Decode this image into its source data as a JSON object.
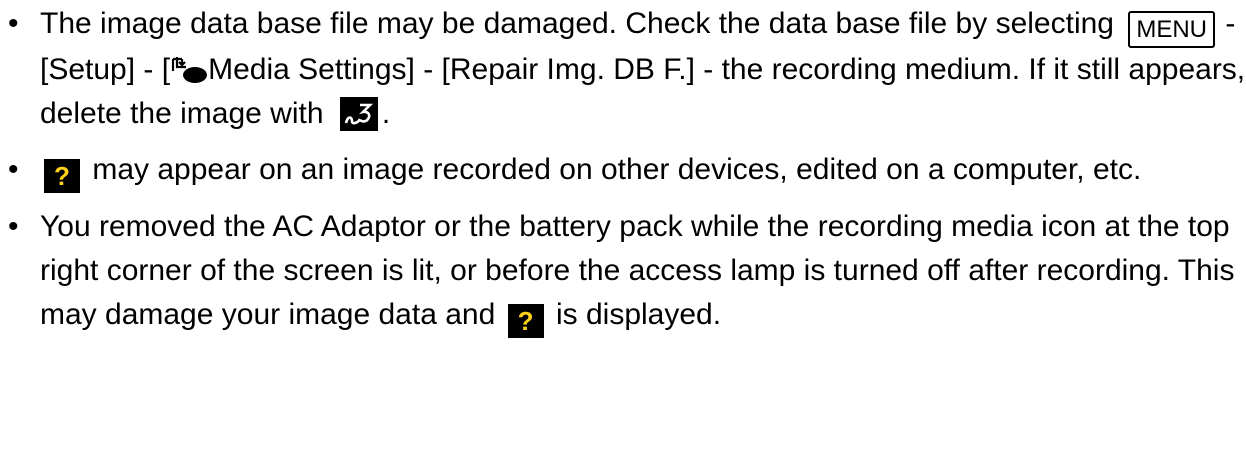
{
  "bullet": "•",
  "item1": {
    "t1": "The image data base file may be damaged. Check the data base file by selecting",
    "menu_key": "MENU",
    "t2": " - [Setup] - [",
    "media_icon": "media-settings-icon",
    "t3": "Media Settings] - [Repair Img. DB F.] - the recording medium. If it still appears, delete the image with",
    "delete_icon": "delete-icon",
    "t4": "."
  },
  "item2": {
    "question_icon_text": "?",
    "t1": "may appear on an image recorded on other devices, edited on a computer, etc."
  },
  "item3": {
    "t1": "You removed the AC Adaptor or the battery pack while the recording media icon at the top right corner of the screen is lit, or before the access lamp is turned off after recording. This may damage your image data and",
    "question_icon_text": "?",
    "t2": "is displayed."
  },
  "colors": {
    "text": "#000000",
    "icon_background": "#000000",
    "question_mark": "#ffd21a"
  }
}
